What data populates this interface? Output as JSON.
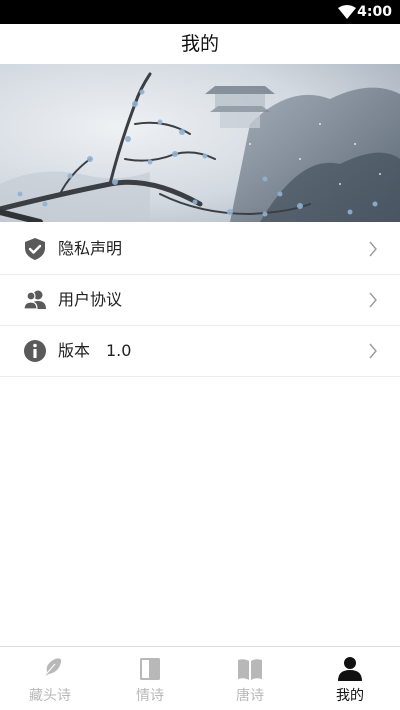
{
  "status_bar": {
    "time": "4:00",
    "wifi_icon": "wifi-icon"
  },
  "header": {
    "title": "我的"
  },
  "banner": {
    "description_icon": "plum-blossom-landscape-image"
  },
  "menu": {
    "items": [
      {
        "label": "隐私声明",
        "icon": "shield-check-icon"
      },
      {
        "label": "用户协议",
        "icon": "users-icon"
      },
      {
        "label": "版本",
        "value": "1.0",
        "icon": "info-icon"
      }
    ],
    "chevron_icon": "chevron-right-icon"
  },
  "bottom_nav": {
    "items": [
      {
        "label": "藏头诗",
        "icon": "feather-icon",
        "active": false
      },
      {
        "label": "情诗",
        "icon": "closed-book-icon",
        "active": false
      },
      {
        "label": "唐诗",
        "icon": "open-book-icon",
        "active": false
      },
      {
        "label": "我的",
        "icon": "person-icon",
        "active": true
      }
    ]
  },
  "colors": {
    "status_bar_bg": "#000000",
    "icon_gray": "#5a5a5a",
    "inactive_nav": "#b8b8b8",
    "active_nav": "#111111",
    "divider": "#ececec"
  }
}
